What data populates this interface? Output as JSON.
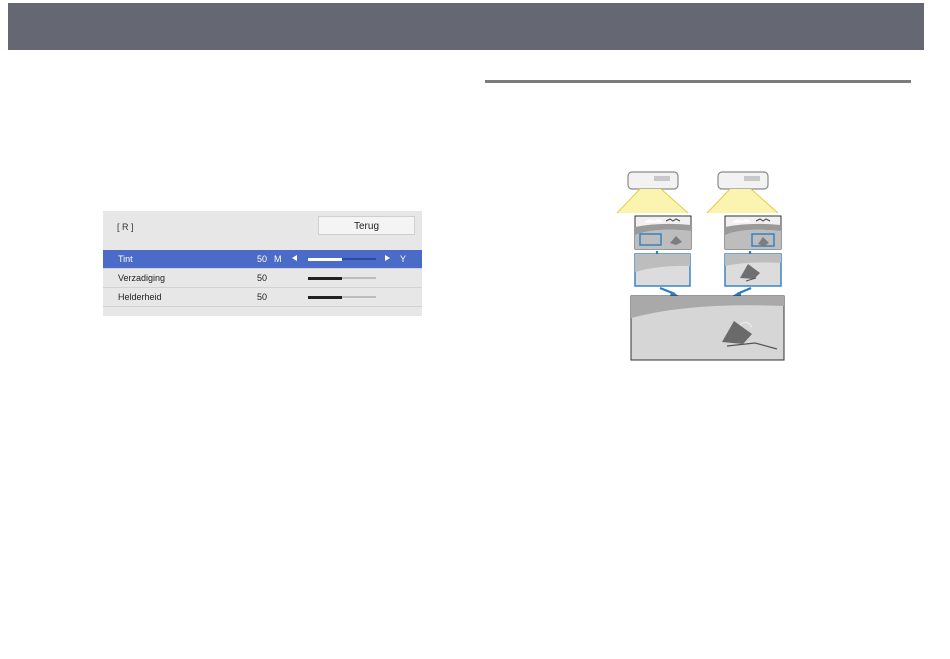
{
  "header": {},
  "menu": {
    "tag": "[ R ]",
    "back_label": "Terug",
    "rows": [
      {
        "label": "Tint",
        "value": "50",
        "left_label": "M",
        "right_label": "Y",
        "level": 0.5,
        "selected": true
      },
      {
        "label": "Verzadiging",
        "value": "50",
        "level": 0.5,
        "selected": false
      },
      {
        "label": "Helderheid",
        "value": "50",
        "level": 0.5,
        "selected": false
      }
    ]
  },
  "colors": {
    "header_bar": "#656773",
    "selection": "#4b6bc8",
    "panel_bg": "#e7e7e7",
    "illustration_frame": "#2e7dbf",
    "projector_beam": "#f2e35a"
  },
  "illustration": {
    "description_icon": "projector-blending-illustration"
  }
}
